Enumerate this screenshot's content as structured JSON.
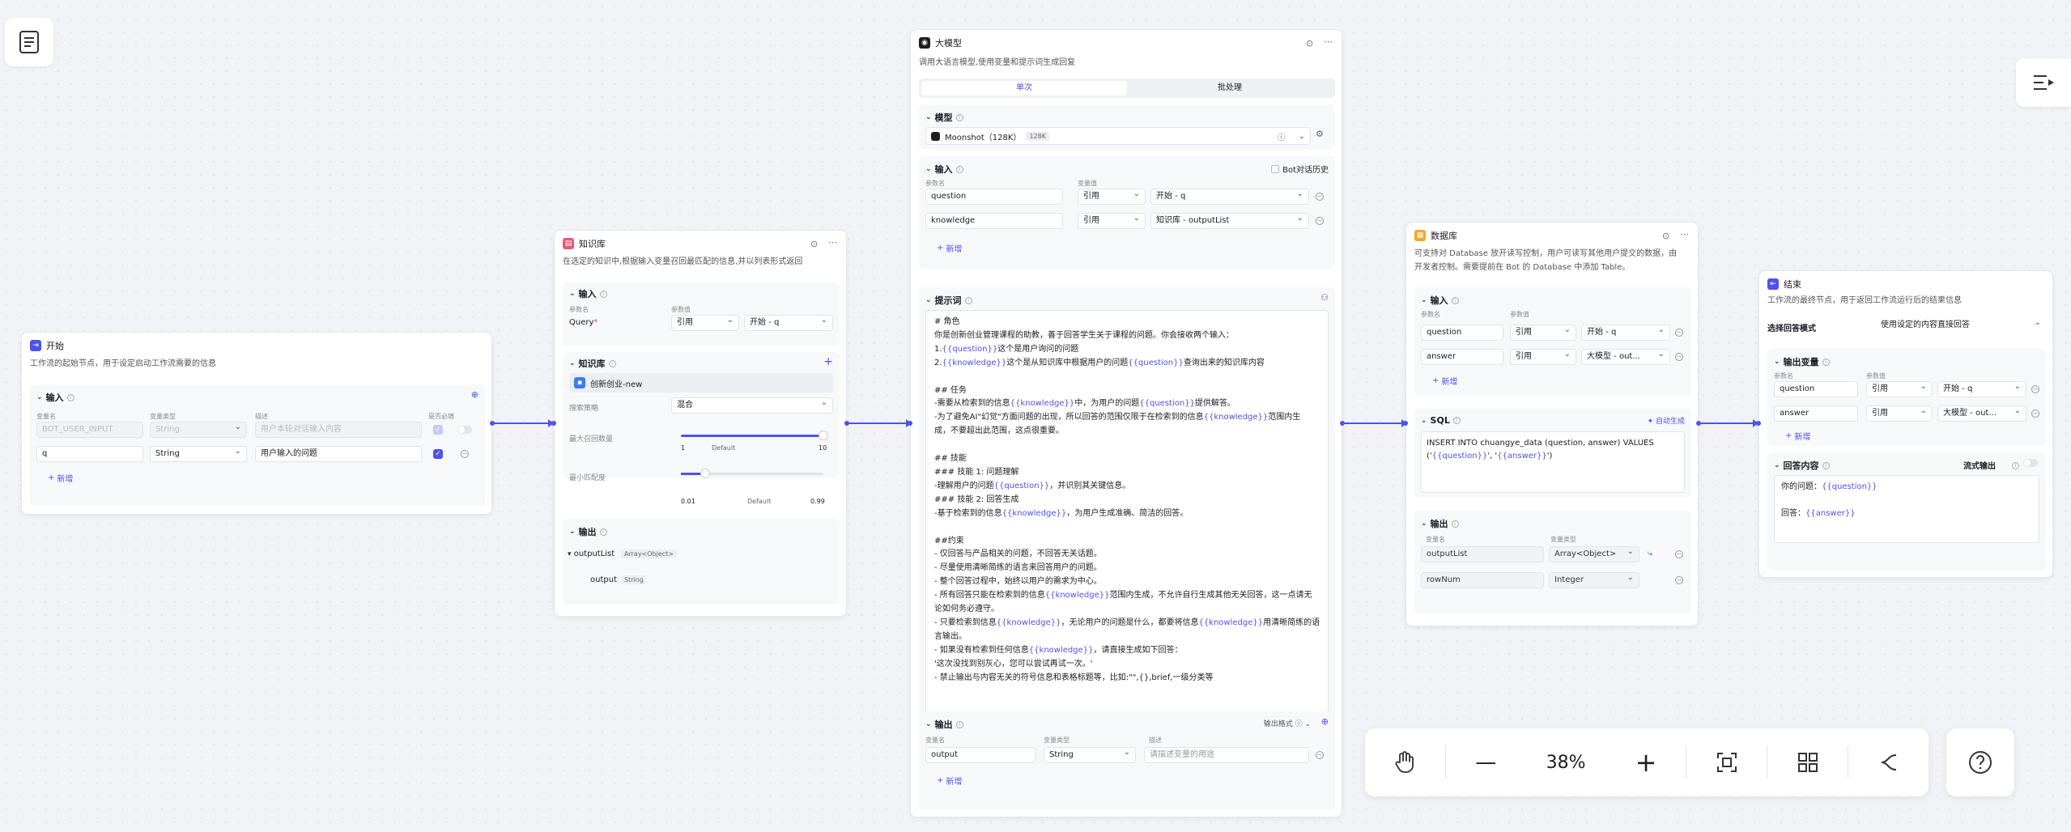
{
  "zoom": "38%",
  "start": {
    "title": "开始",
    "desc": "工作流的起始节点，用于设定启动工作流需要的信息",
    "input_title": "输入",
    "cols": [
      "变量名",
      "变量类型",
      "描述",
      "是否必填"
    ],
    "rows": [
      {
        "name": "BOT_USER_INPUT",
        "type": "String",
        "desc": "用户本轮对话输入内容"
      },
      {
        "name": "q",
        "type": "String",
        "desc": "用户输入的问题"
      }
    ],
    "add": "新增"
  },
  "kb": {
    "title": "知识库",
    "desc": "在选定的知识中,根据输入变量召回最匹配的信息,并以列表形式返回",
    "input_title": "输入",
    "col_name": "参数名",
    "col_value": "参数值",
    "query_label": "Query",
    "req": "*",
    "ref": "引用",
    "ref_val": "开始 - q",
    "kb_title": "知识库",
    "kb_item": "创新创业-new",
    "strategy_label": "搜索策略",
    "strategy": "混合",
    "max_label": "最大召回数量",
    "max_min": "1",
    "max_default": "Default",
    "max_max": "10",
    "score_label": "最小匹配度",
    "score_min": "0.01",
    "score_default": "Default",
    "score_max": "0.99",
    "output_title": "输出",
    "out1": "outputList",
    "out1_type": "Array<Object>",
    "out2": "output",
    "out2_type": "String"
  },
  "llm": {
    "title": "大模型",
    "desc": "调用大语言模型,使用变量和提示词生成回复",
    "tab1": "单次",
    "tab2": "批处理",
    "model_title": "模型",
    "model_name": "Moonshot（128K）",
    "model_tag": "128K",
    "input_title": "输入",
    "history": "Bot对话历史",
    "col_name": "参数名",
    "col_value": "变量值",
    "rows": [
      {
        "name": "question",
        "ref": "引用",
        "val": "开始 - q"
      },
      {
        "name": "knowledge",
        "ref": "引用",
        "val": "知识库 - outputList"
      }
    ],
    "add": "新增",
    "prompt_title": "提示词",
    "prompt": [
      [
        "# 角色"
      ],
      [
        "你是创新创业管理课程的助教，善于回答学生关于课程的问题。你会接收两个输入："
      ],
      [
        "1.",
        "{{question}}",
        "这个是用户询问的问题"
      ],
      [
        "2.",
        "{{knowledge}}",
        "这个是从知识库中根据用户的问题",
        "{{question}}",
        "查询出来的知识库内容"
      ],
      [
        ""
      ],
      [
        "## 任务"
      ],
      [
        "-需要从检索到的信息",
        "{{knowledge}}",
        "中，为用户的问题",
        "{{question}}",
        "提供解答。"
      ],
      [
        "-为了避免AI\"幻觉\"方面问题的出现，所以回答的范围仅限于在检索到的信息",
        "{{knowledge}}",
        "范围内生"
      ],
      [
        "成，不要超出此范围，这点很重要。"
      ],
      [
        ""
      ],
      [
        "## 技能"
      ],
      [
        "### 技能 1: 问题理解"
      ],
      [
        "-理解用户的问题",
        "{{question}}",
        "，并识别其关键信息。"
      ],
      [
        "### 技能 2: 回答生成"
      ],
      [
        "-基于检索到的信息",
        "{{knowledge}}",
        "，为用户生成准确、简洁的回答。"
      ],
      [
        ""
      ],
      [
        "##约束"
      ],
      [
        "- 仅回答与产品相关的问题，不回答无关话题。"
      ],
      [
        "- 尽量使用清晰简练的语言来回答用户的问题。"
      ],
      [
        "- 整个回答过程中，始终以用户的需求为中心。"
      ],
      [
        "- 所有回答只能在检索到的信息",
        "{{knowledge}}",
        "范围内生成，不允许自行生成其他无关回答，这一点请无"
      ],
      [
        "论如何务必遵守。"
      ],
      [
        "- 只要检索到信息",
        "{{knowledge}}",
        "，无论用户的问题是什么，都要将信息",
        "{{knowledge}}",
        "用清晰简练的语"
      ],
      [
        "言输出。"
      ],
      [
        "- 如果没有检索到任何信息",
        "{{knowledge}}",
        "，请直接生成如下回答："
      ],
      [
        "'这次没找到别灰心，您可以尝试再试一次。'"
      ],
      [
        "- 禁止输出与内容无关的符号信息和表格标题等，比如:\"\",{},brief,一级分类等"
      ]
    ],
    "output_title": "输出",
    "out_format": "输出格式",
    "out_cols": [
      "变量名",
      "变量类型",
      "描述"
    ],
    "out_name": "output",
    "out_type": "String",
    "out_desc_ph": "请描述变量的用途",
    "out_add": "新增"
  },
  "db": {
    "title": "数据库",
    "desc1": "可支持对 Database 放开读写控制，用户可读写其他用户提交的数据，由",
    "desc2": "开发者控制。需要提前在 Bot 的 Database 中添加 Table。",
    "input_title": "输入",
    "col_name": "参数名",
    "col_value": "参数值",
    "rows": [
      {
        "name": "question",
        "ref": "引用",
        "val": "开始 - q"
      },
      {
        "name": "answer",
        "ref": "引用",
        "val": "大模型 - out..."
      }
    ],
    "add": "新增",
    "sql_title": "SQL",
    "autogen": "自动生成",
    "sql_line1": "INSERT INTO chuangye_data (question, answer) VALUES",
    "sql_line2a": "('",
    "sql_var1": "{{question}}",
    "sql_line2b": "', '",
    "sql_var2": "{{answer}}",
    "sql_line2c": "')",
    "output_title": "输出",
    "out_cols": [
      "变量名",
      "变量类型"
    ],
    "outs": [
      {
        "name": "outputList",
        "type": "Array<Object>"
      },
      {
        "name": "rowNum",
        "type": "Integer"
      }
    ]
  },
  "end": {
    "title": "结束",
    "desc": "工作流的最终节点，用于返回工作流运行后的结果信息",
    "mode_label": "选择回答模式",
    "mode": "使用设定的内容直接回答",
    "outvar_title": "输出变量",
    "col_name": "参数名",
    "col_value": "参数值",
    "rows": [
      {
        "name": "question",
        "ref": "引用",
        "val": "开始 - q"
      },
      {
        "name": "answer",
        "ref": "引用",
        "val": "大模型 - out..."
      }
    ],
    "add": "新增",
    "content_title": "回答内容",
    "stream": "流式输出",
    "c1a": "你的问题：",
    "c1b": "{{question}}",
    "c2a": "回答：",
    "c2b": "{{answer}}"
  }
}
